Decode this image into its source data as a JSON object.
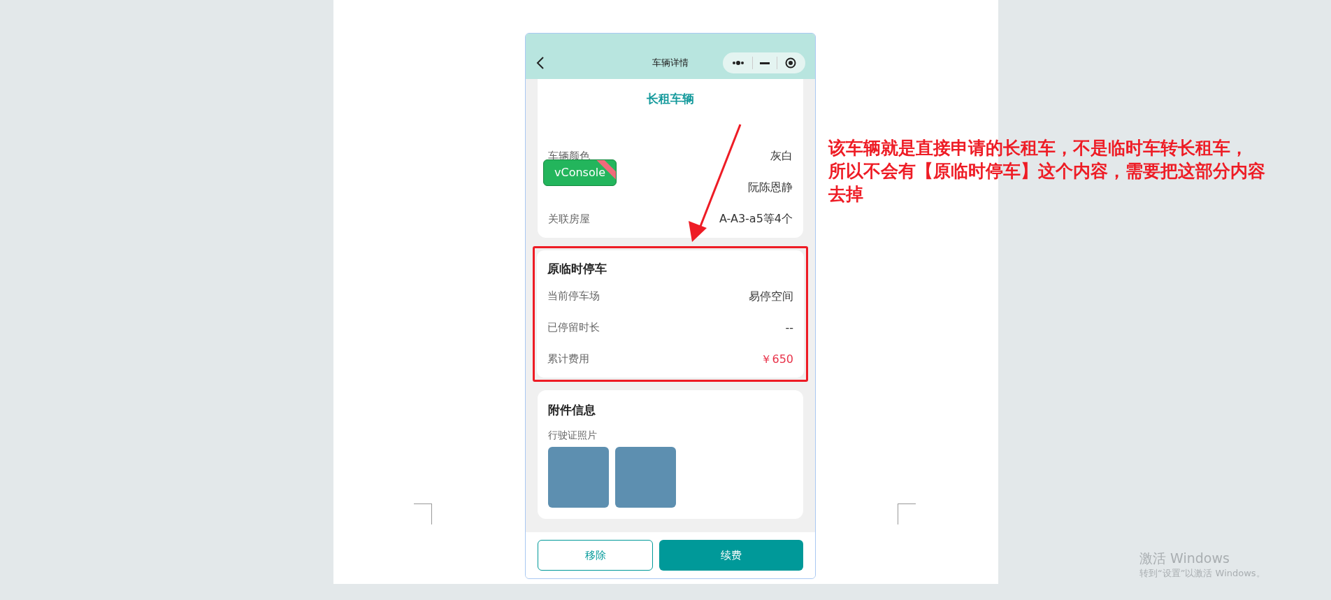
{
  "nav_bar": {
    "title": "车辆详情"
  },
  "vehicle_card": {
    "title": "长租车辆",
    "rows": [
      {
        "label": "车辆颜色",
        "value": "灰白"
      },
      {
        "value": "阮陈恩静"
      },
      {
        "label": "关联房屋",
        "value": "A-A3-a5等4个"
      }
    ]
  },
  "vconsole": {
    "label": "vConsole"
  },
  "temp_parking_card": {
    "title": "原临时停车",
    "rows": [
      {
        "label": "当前停车场",
        "value": "易停空间",
        "kind": "plain"
      },
      {
        "label": "已停留时长",
        "value": "--",
        "kind": "plain"
      },
      {
        "label": "累计费用",
        "value": "￥650",
        "kind": "money"
      }
    ]
  },
  "attachments_card": {
    "title": "附件信息",
    "label": "行驶证照片",
    "photos": [
      {
        "kind": "photo"
      },
      {
        "kind": "photo"
      }
    ]
  },
  "buttons": [
    {
      "label": "移除",
      "kind": "outline"
    },
    {
      "label": "续费",
      "kind": "primary"
    }
  ],
  "annotation": {
    "lines": [
      "该车辆就是直接申请的长租车，不是临时车转长租车，",
      "所以不会有【原临时停车】这个内容，需要把这部分内容",
      "去掉"
    ]
  },
  "windows_notice": {
    "title": "激活 Windows",
    "subtitle": "转到“设置”以激活 Windows。"
  }
}
